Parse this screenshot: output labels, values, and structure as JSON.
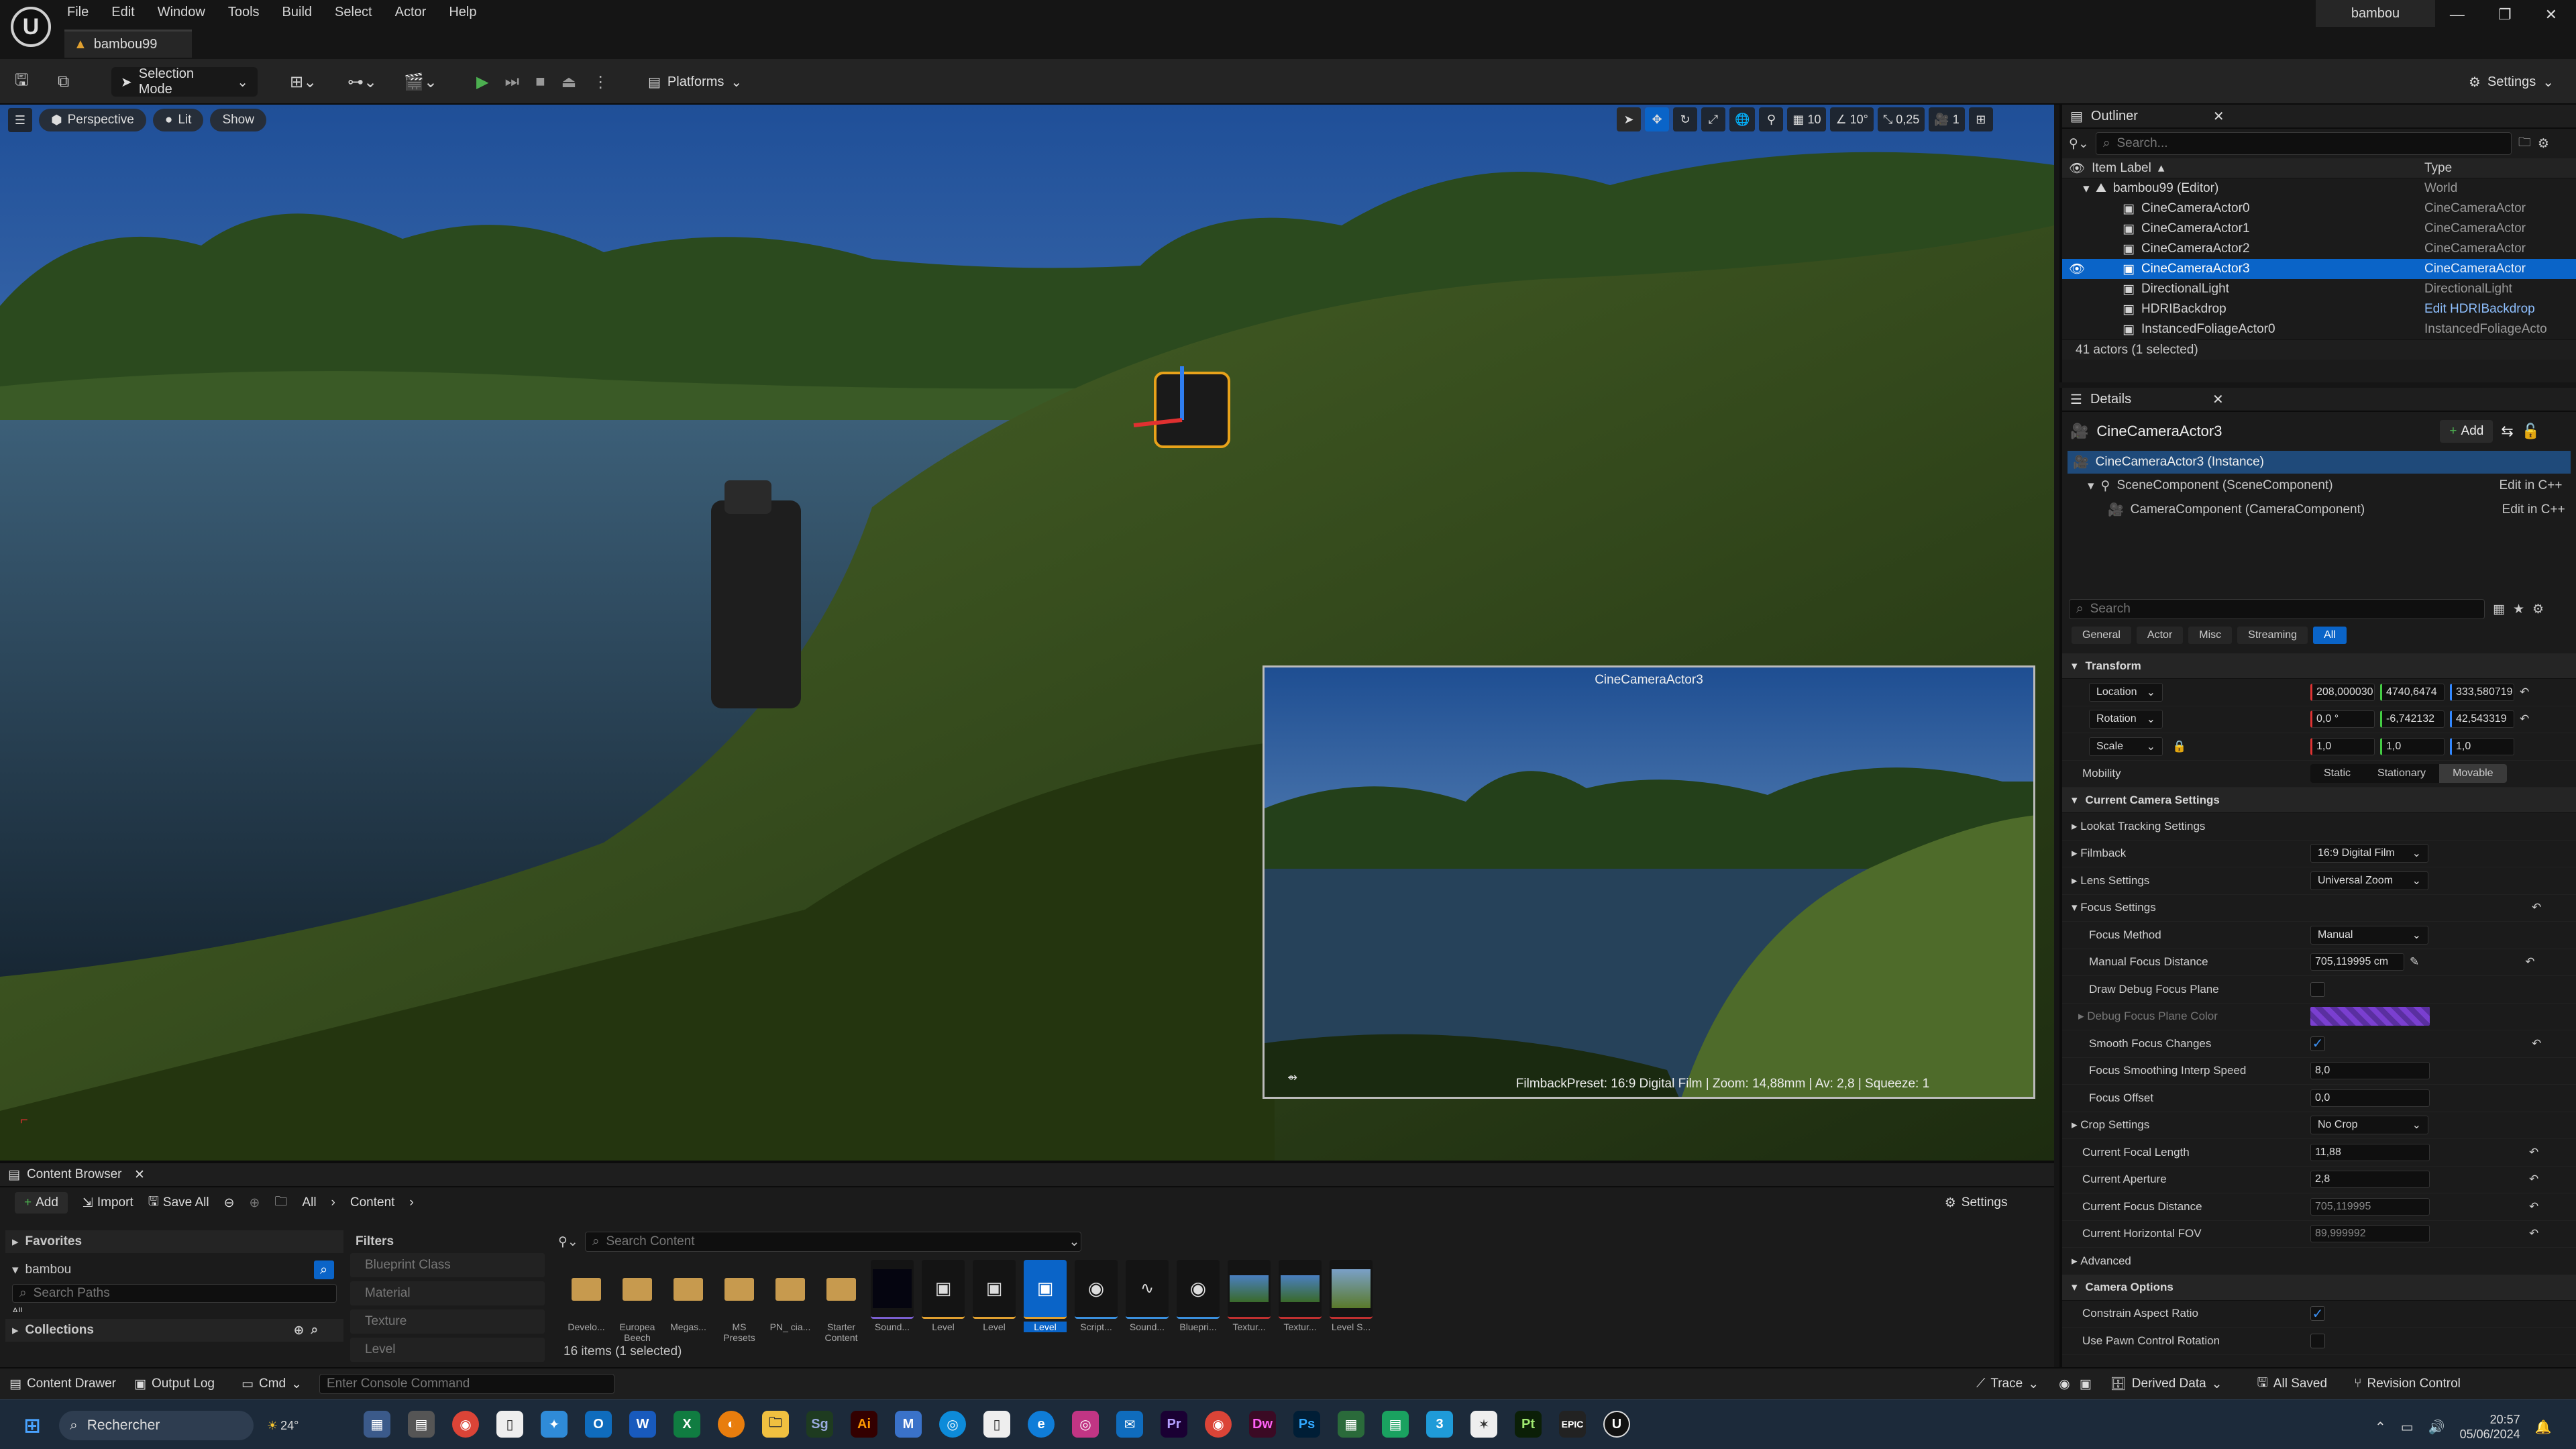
{
  "app": {
    "doc_tab": "bambou99",
    "account": "bambou"
  },
  "menu": [
    "File",
    "Edit",
    "Window",
    "Tools",
    "Build",
    "Select",
    "Actor",
    "Help"
  ],
  "toolbar": {
    "selection_mode": "Selection Mode",
    "platforms": "Platforms",
    "settings": "Settings"
  },
  "viewport": {
    "perspective": "Perspective",
    "lit": "Lit",
    "show": "Show",
    "grid_snap": "10",
    "rot_snap": "10°",
    "scale_snap": "0,25",
    "cam_speed": "1",
    "pip": {
      "title": "CineCameraActor3",
      "info": "FilmbackPreset: 16:9 Digital Film | Zoom: 14,88mm | Av: 2,8 | Squeeze: 1"
    }
  },
  "outliner": {
    "tab": "Outliner",
    "search_placeholder": "Search...",
    "col_label": "Item Label",
    "col_type": "Type",
    "rows": [
      {
        "label": "bambou99 (Editor)",
        "type": "World"
      },
      {
        "label": "CineCameraActor0",
        "type": "CineCameraActor"
      },
      {
        "label": "CineCameraActor1",
        "type": "CineCameraActor"
      },
      {
        "label": "CineCameraActor2",
        "type": "CineCameraActor"
      },
      {
        "label": "CineCameraActor3",
        "type": "CineCameraActor"
      },
      {
        "label": "DirectionalLight",
        "type": "DirectionalLight"
      },
      {
        "label": "HDRIBackdrop",
        "type": "Edit HDRIBackdrop"
      },
      {
        "label": "InstancedFoliageActor0",
        "type": "InstancedFoliageActo"
      }
    ],
    "count": "41 actors (1 selected)"
  },
  "details": {
    "tab": "Details",
    "actor": "CineCameraActor3",
    "add": "Add",
    "instance": "CineCameraActor3 (Instance)",
    "comp1": "SceneComponent (SceneComponent)",
    "comp2": "CameraComponent (CameraComponent)",
    "edit_cpp": "Edit in C++",
    "search_placeholder": "Search",
    "filters": [
      "General",
      "Actor",
      "Misc",
      "Streaming",
      "All"
    ],
    "transform": "Transform",
    "location": {
      "label": "Location",
      "x": "208,000030",
      "y": "4740,6474",
      "z": "333,580719"
    },
    "rotation": {
      "label": "Rotation",
      "x": "0,0 °",
      "y": "-6,742132",
      "z": "42,543319"
    },
    "scale": {
      "label": "Scale",
      "x": "1,0",
      "y": "1,0",
      "z": "1,0"
    },
    "mobility": {
      "label": "Mobility",
      "opts": [
        "Static",
        "Stationary",
        "Movable"
      ]
    },
    "camera_settings": "Current Camera Settings",
    "lookat": "Lookat Tracking Settings",
    "filmback": {
      "label": "Filmback",
      "value": "16:9 Digital Film"
    },
    "lens": {
      "label": "Lens Settings",
      "value": "Universal Zoom"
    },
    "focus": "Focus Settings",
    "focus_method": {
      "label": "Focus Method",
      "value": "Manual"
    },
    "manual_focus": {
      "label": "Manual Focus Distance",
      "value": "705,119995 cm"
    },
    "draw_debug": {
      "label": "Draw Debug Focus Plane"
    },
    "debug_color": {
      "label": "Debug Focus Plane Color",
      "color": "#7a3fd0"
    },
    "smooth": {
      "label": "Smooth Focus Changes"
    },
    "smooth_speed": {
      "label": "Focus Smoothing Interp Speed",
      "value": "8,0"
    },
    "focus_offset": {
      "label": "Focus Offset",
      "value": "0,0"
    },
    "crop": {
      "label": "Crop Settings",
      "value": "No Crop"
    },
    "focal": {
      "label": "Current Focal Length",
      "value": "11,88"
    },
    "aperture": {
      "label": "Current Aperture",
      "value": "2,8"
    },
    "focus_dist": {
      "label": "Current Focus Distance",
      "value": "705,119995"
    },
    "fov": {
      "label": "Current Horizontal FOV",
      "value": "89,999992"
    },
    "advanced": "Advanced",
    "camera_options": "Camera Options",
    "constrain": {
      "label": "Constrain Aspect Ratio"
    },
    "pawn": {
      "label": "Use Pawn Control Rotation"
    }
  },
  "content_browser": {
    "tab": "Content Browser",
    "add": "Add",
    "import": "Import",
    "save_all": "Save All",
    "crumb_all": "All",
    "crumb_content": "Content",
    "settings": "Settings",
    "favorites": "Favorites",
    "project": "bambou",
    "search_paths": "Search Paths",
    "all": "All",
    "collections": "Collections",
    "filters_title": "Filters",
    "filters": [
      "Blueprint Class",
      "Material",
      "Texture",
      "Level"
    ],
    "search_content": "Search Content",
    "items_count": "16 items (1 selected)",
    "assets": [
      {
        "label": "Develo...",
        "kind": "folder"
      },
      {
        "label": "Europea Beech",
        "kind": "folder"
      },
      {
        "label": "Megas...",
        "kind": "folder"
      },
      {
        "label": "MS Presets",
        "kind": "folder"
      },
      {
        "label": "PN_ cia...",
        "kind": "folder"
      },
      {
        "label": "Starter Content",
        "kind": "folder"
      },
      {
        "label": "Sound...",
        "kind": "dark"
      },
      {
        "label": "Level",
        "kind": "level"
      },
      {
        "label": "Level",
        "kind": "level"
      },
      {
        "label": "Level",
        "kind": "level-sel"
      },
      {
        "label": "Script...",
        "kind": "ball"
      },
      {
        "label": "Sound...",
        "kind": "wave"
      },
      {
        "label": "Bluepri...",
        "kind": "ball"
      },
      {
        "label": "Textur...",
        "kind": "sky"
      },
      {
        "label": "Textur...",
        "kind": "sky"
      },
      {
        "label": "Level S...",
        "kind": "grass"
      }
    ]
  },
  "statusbar": {
    "content_drawer": "Content Drawer",
    "output_log": "Output Log",
    "cmd": "Cmd",
    "console_placeholder": "Enter Console Command",
    "trace": "Trace",
    "derived": "Derived Data",
    "saved": "All Saved",
    "revision": "Revision Control"
  },
  "taskbar": {
    "search": "Rechercher",
    "weather": "24°",
    "time": "20:57",
    "date": "05/06/2024"
  }
}
